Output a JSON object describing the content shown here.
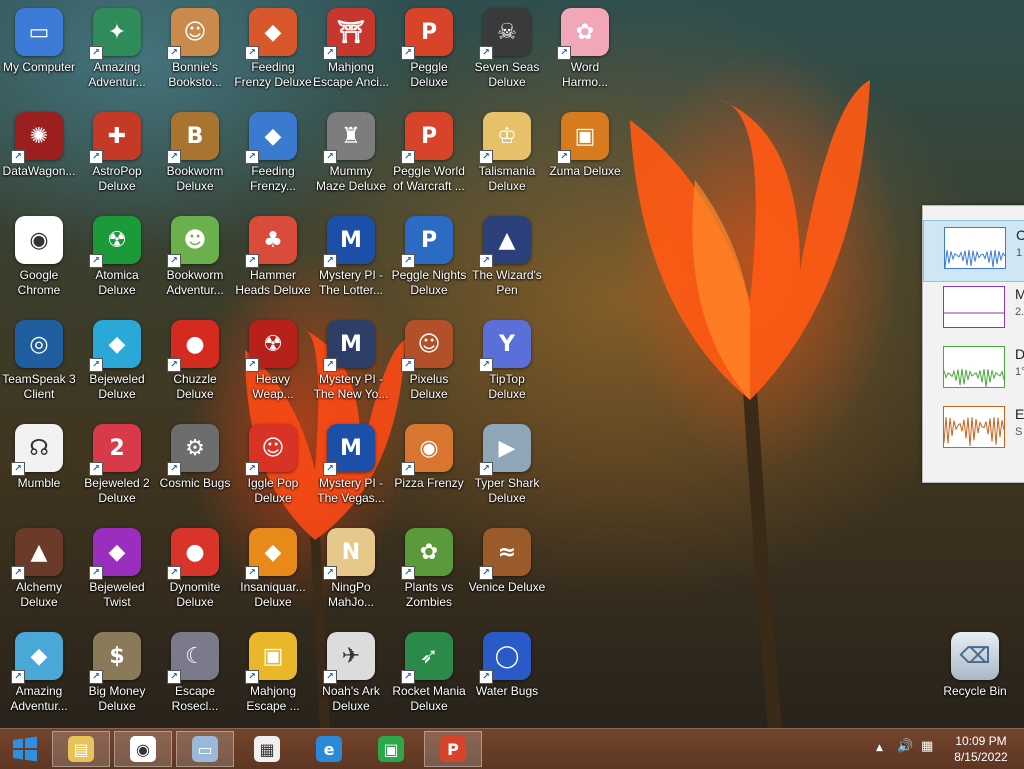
{
  "desktop": {
    "icons": [
      {
        "label": "My Computer",
        "icon": "computer-icon",
        "color": "#3d7bd8",
        "glyph": "▭",
        "col": 0,
        "row": 0,
        "shortcut": false
      },
      {
        "label": "Amazing\nAdventur...",
        "icon": "compass-icon",
        "color": "#2f8c5a",
        "glyph": "✦",
        "col": 1,
        "row": 0,
        "shortcut": true
      },
      {
        "label": "Bonnie's\nBooksto...",
        "icon": "bonnie-icon",
        "color": "#c98a4b",
        "glyph": "☺",
        "col": 2,
        "row": 0,
        "shortcut": true
      },
      {
        "label": "Feeding\nFrenzy Deluxe",
        "icon": "fish-icon",
        "color": "#d9582b",
        "glyph": "◆",
        "col": 3,
        "row": 0,
        "shortcut": true
      },
      {
        "label": "Mahjong\nEscape Anci...",
        "icon": "mahjong-gate-icon",
        "color": "#c8372d",
        "glyph": "⛩",
        "col": 4,
        "row": 0,
        "shortcut": true
      },
      {
        "label": "Peggle Deluxe",
        "icon": "peggle-icon",
        "color": "#d8442a",
        "glyph": "P",
        "col": 5,
        "row": 0,
        "shortcut": true
      },
      {
        "label": "Seven Seas\nDeluxe",
        "icon": "skull-icon",
        "color": "#3a3a3a",
        "glyph": "☠",
        "col": 6,
        "row": 0,
        "shortcut": true
      },
      {
        "label": "Word\nHarmo...",
        "icon": "flower-icon",
        "color": "#f1a7b8",
        "glyph": "✿",
        "col": 7,
        "row": 0,
        "shortcut": true
      },
      {
        "label": "DataWagon...",
        "icon": "datawagon-icon",
        "color": "#9c1f1f",
        "glyph": "✺",
        "col": 0,
        "row": 1,
        "shortcut": true
      },
      {
        "label": "AstroPop\nDeluxe",
        "icon": "astropop-icon",
        "color": "#c43a26",
        "glyph": "✚",
        "col": 1,
        "row": 1,
        "shortcut": true
      },
      {
        "label": "Bookworm\nDeluxe",
        "icon": "bookworm-icon",
        "color": "#a9742f",
        "glyph": "B",
        "col": 2,
        "row": 1,
        "shortcut": true
      },
      {
        "label": "Feeding\nFrenzy...",
        "icon": "fish-blue-icon",
        "color": "#3a7bd0",
        "glyph": "◆",
        "col": 3,
        "row": 1,
        "shortcut": true
      },
      {
        "label": "Mummy\nMaze Deluxe",
        "icon": "mummy-icon",
        "color": "#7d7d7d",
        "glyph": "♜",
        "col": 4,
        "row": 1,
        "shortcut": true
      },
      {
        "label": "Peggle World\nof Warcraft ...",
        "icon": "peggle-icon",
        "color": "#d8442a",
        "glyph": "P",
        "col": 5,
        "row": 1,
        "shortcut": true
      },
      {
        "label": "Talismania\nDeluxe",
        "icon": "talismania-icon",
        "color": "#e6c16a",
        "glyph": "♔",
        "col": 6,
        "row": 1,
        "shortcut": true
      },
      {
        "label": "Zuma Deluxe",
        "icon": "zuma-icon",
        "color": "#d87a1e",
        "glyph": "▣",
        "col": 7,
        "row": 1,
        "shortcut": true
      },
      {
        "label": "Google\nChrome",
        "icon": "chrome-icon",
        "color": "#ffffff",
        "glyph": "◉",
        "col": 0,
        "row": 2,
        "shortcut": false
      },
      {
        "label": "Atomica\nDeluxe",
        "icon": "atomica-icon",
        "color": "#1c9a3a",
        "glyph": "☢",
        "col": 1,
        "row": 2,
        "shortcut": true
      },
      {
        "label": "Bookworm\nAdventur...",
        "icon": "bookworm-adventure-icon",
        "color": "#6ab04c",
        "glyph": "☻",
        "col": 2,
        "row": 2,
        "shortcut": true
      },
      {
        "label": "Hammer\nHeads Deluxe",
        "icon": "gnome-icon",
        "color": "#d94b3a",
        "glyph": "♣",
        "col": 3,
        "row": 2,
        "shortcut": true
      },
      {
        "label": "Mystery PI -\nThe Lotter...",
        "icon": "mystery-pi-icon",
        "color": "#1c4fa8",
        "glyph": "M",
        "col": 4,
        "row": 2,
        "shortcut": true
      },
      {
        "label": "Peggle Nights\nDeluxe",
        "icon": "peggle-nights-icon",
        "color": "#2c6bc4",
        "glyph": "P",
        "col": 5,
        "row": 2,
        "shortcut": true
      },
      {
        "label": "The Wizard's\nPen",
        "icon": "wizard-icon",
        "color": "#2b3f7a",
        "glyph": "▲",
        "col": 6,
        "row": 2,
        "shortcut": true
      },
      {
        "label": "TeamSpeak 3\nClient",
        "icon": "teamspeak-icon",
        "color": "#1f5fa0",
        "glyph": "◎",
        "col": 0,
        "row": 3,
        "shortcut": false
      },
      {
        "label": "Bejeweled\nDeluxe",
        "icon": "gem-icon",
        "color": "#2aa8d8",
        "glyph": "◆",
        "col": 1,
        "row": 3,
        "shortcut": true
      },
      {
        "label": "Chuzzle\nDeluxe",
        "icon": "chuzzle-icon",
        "color": "#d42a20",
        "glyph": "●",
        "col": 2,
        "row": 3,
        "shortcut": true
      },
      {
        "label": "Heavy\nWeap...",
        "icon": "radiation-icon",
        "color": "#b8201c",
        "glyph": "☢",
        "col": 3,
        "row": 3,
        "shortcut": true
      },
      {
        "label": "Mystery PI -\nThe New Yo...",
        "icon": "mystery-pi-shield-icon",
        "color": "#2d3f66",
        "glyph": "M",
        "col": 4,
        "row": 3,
        "shortcut": true
      },
      {
        "label": "Pixelus Deluxe",
        "icon": "pixelus-icon",
        "color": "#b2502a",
        "glyph": "☺",
        "col": 5,
        "row": 3,
        "shortcut": true
      },
      {
        "label": "TipTop\nDeluxe",
        "icon": "cocktail-icon",
        "color": "#5a6fd8",
        "glyph": "Y",
        "col": 6,
        "row": 3,
        "shortcut": true
      },
      {
        "label": "Mumble",
        "icon": "mumble-icon",
        "color": "#f2f2f2",
        "glyph": "☊",
        "col": 0,
        "row": 4,
        "shortcut": true
      },
      {
        "label": "Bejeweled 2\nDeluxe",
        "icon": "gem-2-icon",
        "color": "#d83a4a",
        "glyph": "2",
        "col": 1,
        "row": 4,
        "shortcut": true
      },
      {
        "label": "Cosmic Bugs",
        "icon": "gear-bug-icon",
        "color": "#6d6d6d",
        "glyph": "⚙",
        "col": 2,
        "row": 4,
        "shortcut": true
      },
      {
        "label": "Iggle Pop\nDeluxe",
        "icon": "iggle-pop-icon",
        "color": "#d83326",
        "glyph": "☺",
        "col": 3,
        "row": 4,
        "shortcut": true
      },
      {
        "label": "Mystery PI -\nThe Vegas...",
        "icon": "mystery-pi-icon",
        "color": "#1c4fa8",
        "glyph": "M",
        "col": 4,
        "row": 4,
        "shortcut": true
      },
      {
        "label": "Pizza Frenzy",
        "icon": "pizza-icon",
        "color": "#d8752e",
        "glyph": "◉",
        "col": 5,
        "row": 4,
        "shortcut": true
      },
      {
        "label": "Typer Shark\nDeluxe",
        "icon": "shark-icon",
        "color": "#8fa6b8",
        "glyph": "▶",
        "col": 6,
        "row": 4,
        "shortcut": true
      },
      {
        "label": "Alchemy\nDeluxe",
        "icon": "alchemist-icon",
        "color": "#6b3b2a",
        "glyph": "▲",
        "col": 0,
        "row": 5,
        "shortcut": true
      },
      {
        "label": "Bejeweled\nTwist",
        "icon": "gem-twist-icon",
        "color": "#9a2fbf",
        "glyph": "◆",
        "col": 1,
        "row": 5,
        "shortcut": true
      },
      {
        "label": "Dynomite\nDeluxe",
        "icon": "egg-icon",
        "color": "#d8342a",
        "glyph": "●",
        "col": 2,
        "row": 5,
        "shortcut": true
      },
      {
        "label": "Insaniquar...\nDeluxe",
        "icon": "goldfish-icon",
        "color": "#e88a1a",
        "glyph": "◆",
        "col": 3,
        "row": 5,
        "shortcut": true
      },
      {
        "label": "NingPo\nMahJo...",
        "icon": "ningpo-icon",
        "color": "#e6c98a",
        "glyph": "N",
        "col": 4,
        "row": 5,
        "shortcut": true
      },
      {
        "label": "Plants vs\nZombies",
        "icon": "plant-icon",
        "color": "#5a9a3a",
        "glyph": "✿",
        "col": 5,
        "row": 5,
        "shortcut": true
      },
      {
        "label": "Venice Deluxe",
        "icon": "gondola-icon",
        "color": "#9a5a2a",
        "glyph": "≈",
        "col": 6,
        "row": 5,
        "shortcut": true
      },
      {
        "label": "Amazing\nAdventur...",
        "icon": "diamond-icon",
        "color": "#4aa8d8",
        "glyph": "◆",
        "col": 0,
        "row": 6,
        "shortcut": true
      },
      {
        "label": "Big Money\nDeluxe",
        "icon": "money-bag-icon",
        "color": "#8a7a5a",
        "glyph": "$",
        "col": 1,
        "row": 6,
        "shortcut": true
      },
      {
        "label": "Escape\nRosecl...",
        "icon": "moon-icon",
        "color": "#7a7a8a",
        "glyph": "☾",
        "col": 2,
        "row": 6,
        "shortcut": true
      },
      {
        "label": "Mahjong\nEscape ...",
        "icon": "mahjong-tile-icon",
        "color": "#e8b82a",
        "glyph": "▣",
        "col": 3,
        "row": 6,
        "shortcut": true
      },
      {
        "label": "Noah's Ark\nDeluxe",
        "icon": "dove-icon",
        "color": "#dcdcdc",
        "glyph": "✈",
        "col": 4,
        "row": 6,
        "shortcut": true
      },
      {
        "label": "Rocket Mania\nDeluxe",
        "icon": "rocket-icon",
        "color": "#2a8a4a",
        "glyph": "➶",
        "col": 5,
        "row": 6,
        "shortcut": true
      },
      {
        "label": "Water Bugs",
        "icon": "water-bubble-icon",
        "color": "#2a5ac8",
        "glyph": "◯",
        "col": 6,
        "row": 6,
        "shortcut": true
      }
    ],
    "recycle_bin": {
      "label": "Recycle Bin",
      "icon": "recycle-bin-icon"
    }
  },
  "monitor": {
    "rows": [
      {
        "title": "C",
        "value": "1",
        "color": "#3d7bd8",
        "selected": true
      },
      {
        "title": "M",
        "value": "2.",
        "color": "#8a3aa8",
        "selected": false
      },
      {
        "title": "D",
        "value": "1°",
        "color": "#4aa83a",
        "selected": false
      },
      {
        "title": "E",
        "value": "S",
        "color": "#c8641e",
        "selected": false
      }
    ]
  },
  "taskbar": {
    "start": {
      "icon": "windows-start-icon",
      "color": "#2f8fe0"
    },
    "items": [
      {
        "name": "file-explorer",
        "icon": "folder-icon",
        "color": "#e8c35a",
        "pinned": true
      },
      {
        "name": "chrome",
        "icon": "chrome-icon",
        "color": "#ffffff",
        "pinned": true
      },
      {
        "name": "resource-monitor",
        "icon": "monitor-icon",
        "color": "#9ab8d8",
        "pinned": true
      },
      {
        "name": "game-app",
        "icon": "pixel-game-icon",
        "color": "#f0f0f0",
        "pinned": false
      },
      {
        "name": "internet-explorer",
        "icon": "ie-icon",
        "color": "#2a8ad8",
        "pinned": false
      },
      {
        "name": "store",
        "icon": "store-icon",
        "color": "#2aa84a",
        "pinned": false
      },
      {
        "name": "peggle",
        "icon": "peggle-icon",
        "color": "#d8442a",
        "pinned": true
      }
    ],
    "tray": {
      "show_hidden": "▲",
      "volume": "🔊",
      "network": "▦"
    },
    "clock": {
      "time": "10:09 PM",
      "date": "8/15/2022"
    }
  }
}
